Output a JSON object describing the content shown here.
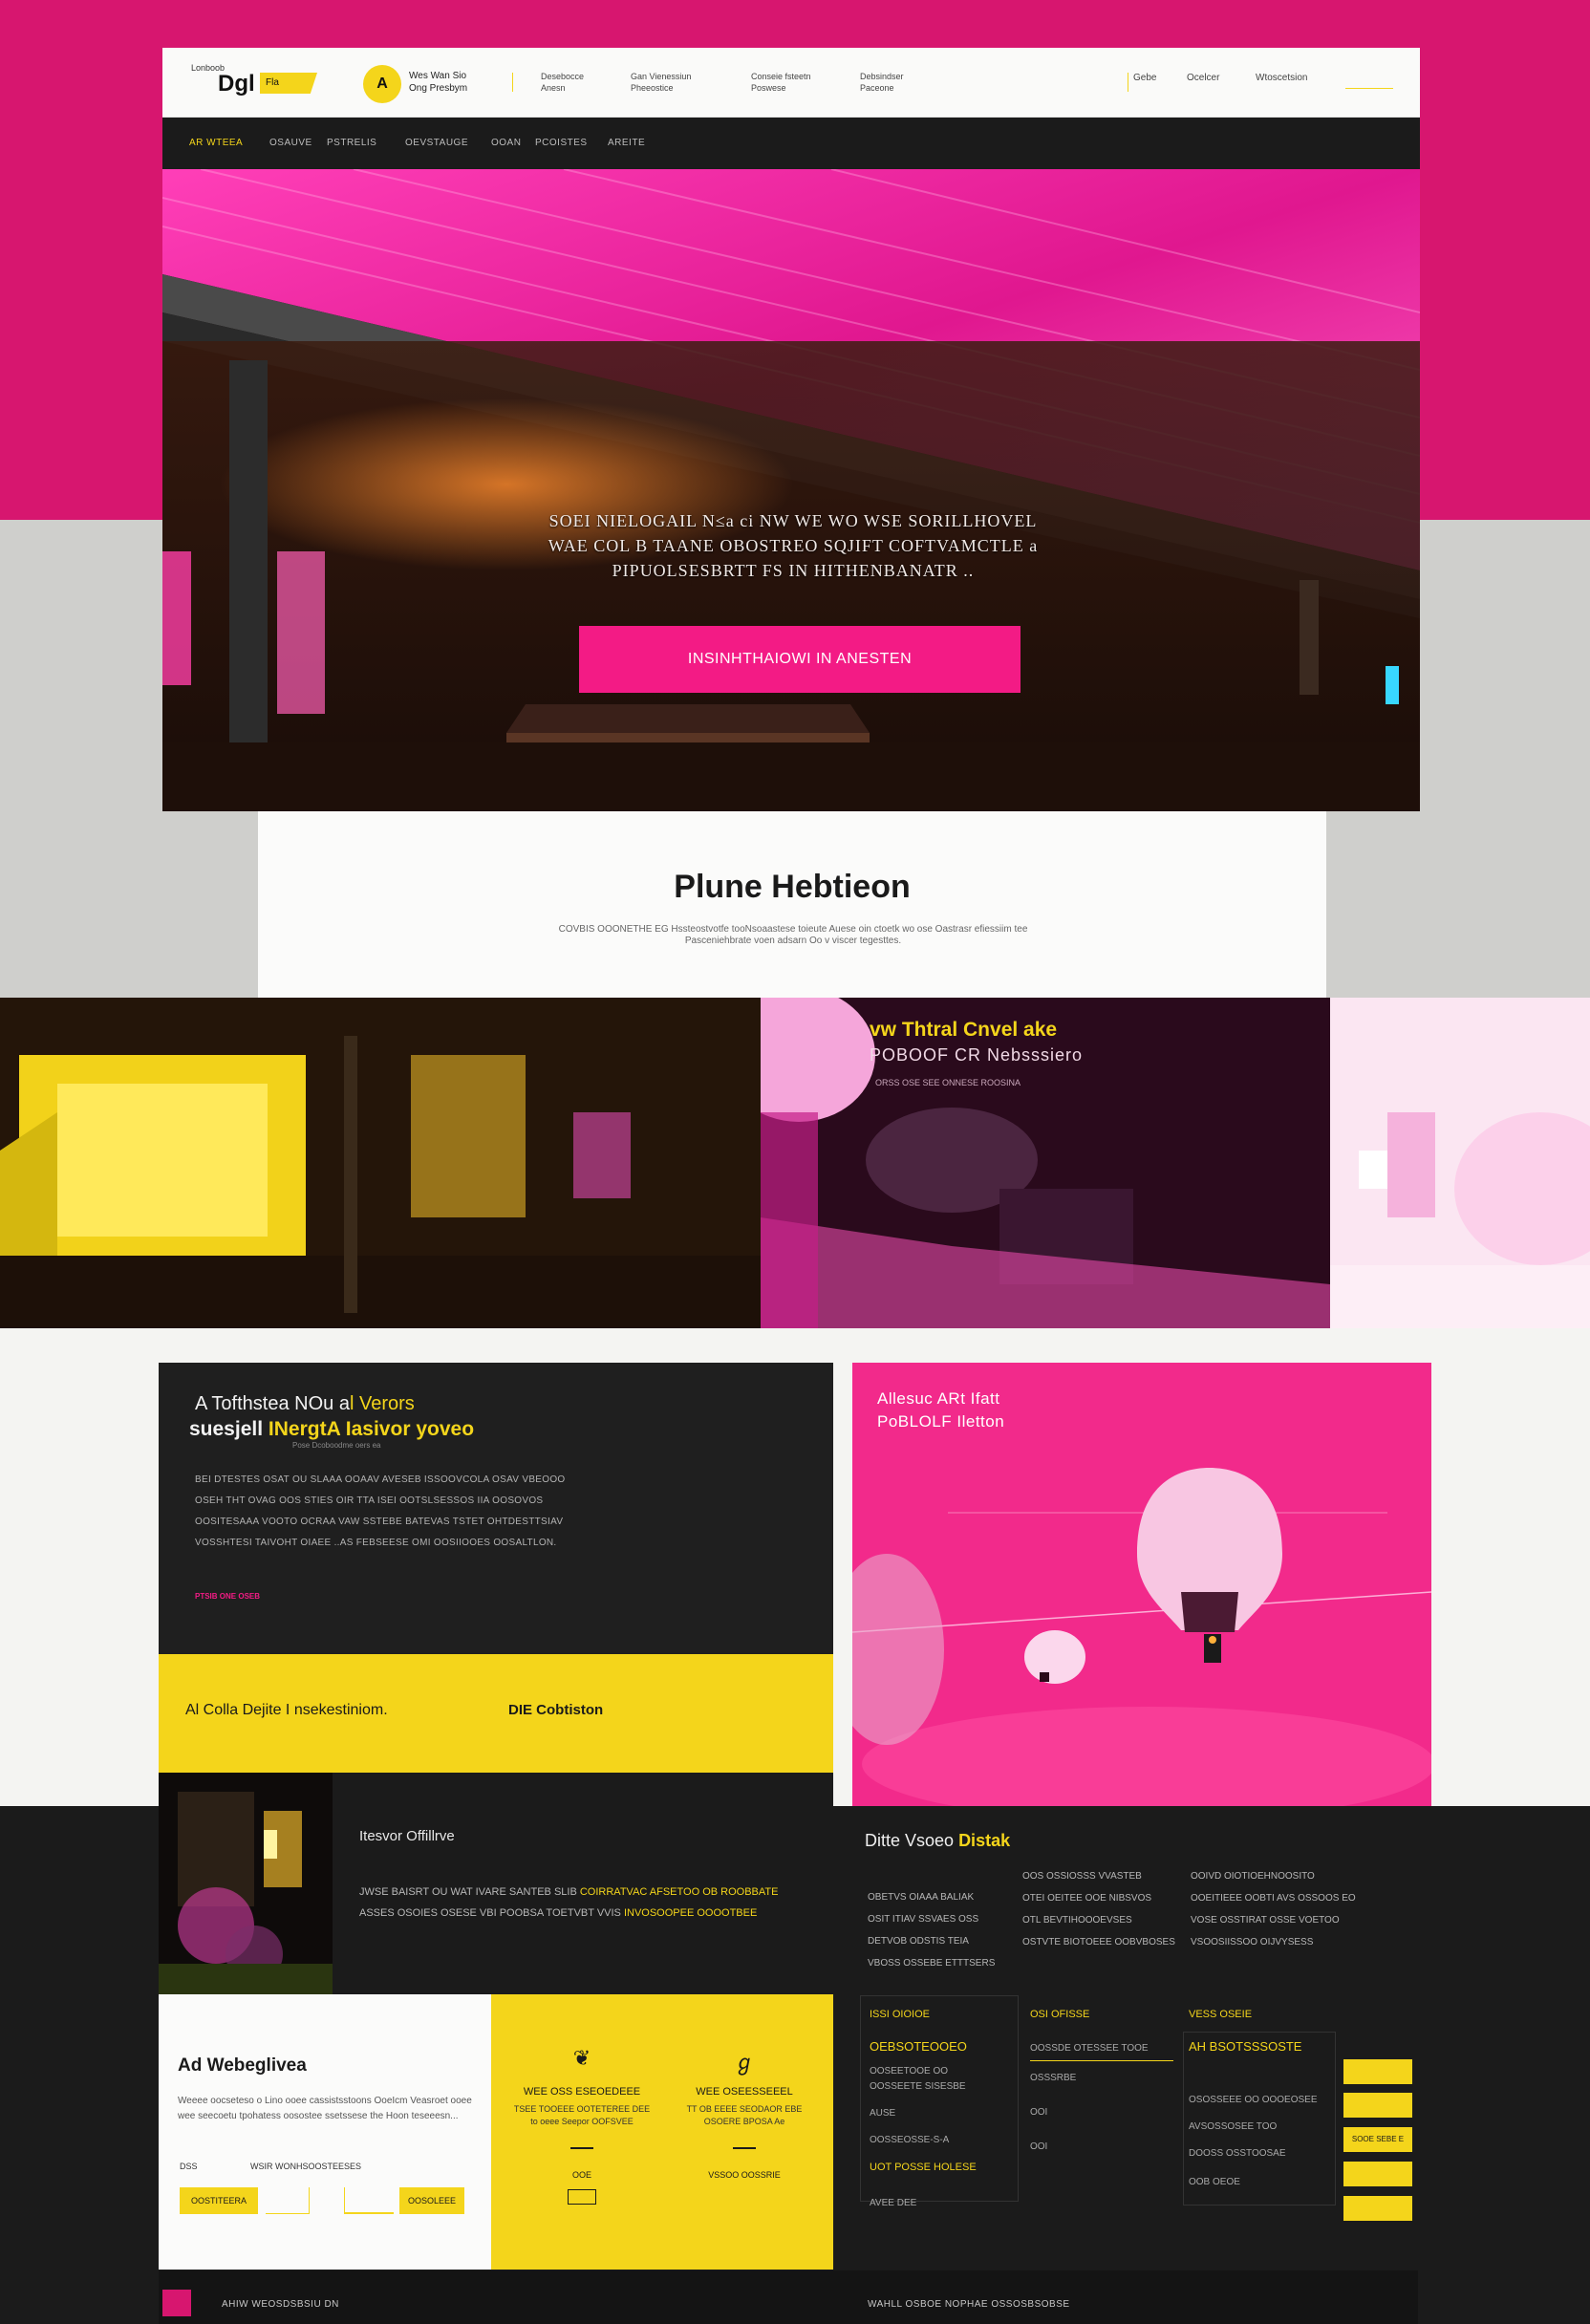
{
  "colors": {
    "brand_pink": "#d7166f",
    "cta_pink": "#f31b85",
    "accent_yellow": "#f4d51b",
    "dark": "#1b1b1b"
  },
  "header": {
    "logo_small": "Lonboob",
    "logo_text": "Dgl",
    "logo_tag": "Fla",
    "badge_letter": "A",
    "badge_line1": "Wes Wan Sio",
    "badge_line2": "Ong Presbym",
    "links": [
      {
        "line1": "Desebocce",
        "line2": "Anesn"
      },
      {
        "line1": "Gan Vienessiun",
        "line2": "Pheeostice"
      },
      {
        "line1": "Conseie fsteetn",
        "line2": "Poswese"
      },
      {
        "line1": "Debsindser",
        "line2": "Paceone"
      }
    ],
    "nav": [
      "Gebe",
      "Ocelcer",
      "Wtoscetsion"
    ]
  },
  "nav_bar": {
    "items": [
      "AR WTEEA",
      "OSAUVE",
      "PSTRELIS",
      "OEVSTAUGE",
      "OOAN",
      "PCOISTES",
      "AREITE"
    ]
  },
  "hero": {
    "text_line1": "SOEI NIELOGAIL N≤a ci NW WE WO WSE SORILLHOVEL",
    "text_line2": "WAE COL B TAANE OBOSTREO SQJIFT COFTVAMCTLE a",
    "text_line3": "PIPUOLSESBRTT  FS  IN HITHENBANATR ..",
    "cta": "INSINHTHAIOWI  IN ANESTEN"
  },
  "intro": {
    "title": "Plune Hebtieon",
    "text": "COVBIS OOONETHE EG Hssteostvotfe tooNsoaastese toieute Auese oin ctoetk wo ose Oastrasr efiessiim tee Pasceniehbrate voen adsarn Oo v viscer tegesttes."
  },
  "gallery": {
    "title": "vw Thtral Cnvel ake",
    "subtitle": "POBOOF CR Nebsssiero",
    "small": "ORSS OSE SEE ONNESE ROOSINA"
  },
  "feature_dark": {
    "title1_a": "A Tofthstea NOu a",
    "title1_b": "l Verors",
    "title2_a": "suesjell ",
    "title2_b": "INergtA Iasivor yoveo",
    "tiny": "Pose Dcoboodme oers ea",
    "body": [
      "BEI DTESTES OSAT OU SLAAA OOAAV AVESEB ISSOOVCOLA OSAV VBEOOO",
      "OSEH THT OVAG OOS STIES OIR TTA ISEI OOTSLSESSOS IIA OOSOVOS",
      "OOSITESAAA VOOTO OCRAA VAW SSTEBE BATEVAS TSTET OHTDESTTSIAV",
      "VOSSHTESI TAIVOHT OIAEE ..AS FEBSEESE OMI OOSIIOOES OOSALTLON."
    ],
    "link": "PTSIB ONE OSEB"
  },
  "yellow_banner": {
    "left": "Al Colla Dejite I nsekestiniom.",
    "right": "DIE Cobtiston"
  },
  "story": {
    "title": "Itesvor Offillrve",
    "body_line1_a": "JWSE BAISRT OU WAT IVARE SANTEB SLIB ",
    "body_line1_b": "COIRRATVAC AFSETOO OB ROOBBATE",
    "body_line2_a": "ASSES OSOIES OSESE VBI POOBSA TOETVBT VVIS ",
    "body_line2_b": "INVOSOOPEE OOOOTBEE"
  },
  "detail": {
    "title_a": "Ditte Vsoeo ",
    "title_b": "Distak",
    "cols": [
      [
        "OBETVS OIAAA BALIAK",
        "OSIT ITIAV SSVAES OSS",
        "DETVOB ODSTIS TEIA",
        "VBOSS OSSEBE ETTTSERS"
      ],
      [
        "OOS OSSIOSSS VVASTEB",
        "OTEI OEITEE OOE NIBSVOS",
        "OTL BEVTIHOOOEVSES",
        "OSTVTE BIOTOEEE OOBVBOSES"
      ],
      [
        "OOIVD OIOTIOEHNOOSITO",
        "OOEITIEEE OOBTI AVS OSSOOS EO",
        "VOSE OSSTIRAT OSSE VOETOO",
        "VSOOSIISSOO OIJVYSESS"
      ]
    ]
  },
  "card_white": {
    "title": "Ad Webeglivea",
    "body": "Weeee oocseteso o Lino ooee cassistsstoons OoeIcm Veasroet ooee wee seecoetu tpohatess oosostee ssetssese the Hoon teseeesn...",
    "label1": "DSS",
    "label2": "WSIR WONHSOOSTEESES",
    "buttons": [
      "OOSTITEERA",
      "OOSOLEEE"
    ]
  },
  "card_yellow": {
    "cols": [
      {
        "icon": "❦",
        "head": "WEE OSS ESEOEDEEE",
        "sub": "TSEE TOOEEE OOTETEREE DEE to oeee Seepor OOFSVEE",
        "extra": "OOE"
      },
      {
        "icon": "ℊ",
        "head": "WEE OSEESSEEEL",
        "sub": "TT OB EEEE SEODAOR EBE OSOERE BPOSA Ae",
        "extra": "VSSOO OOSSRIE"
      }
    ]
  },
  "info": {
    "col1": {
      "head": "ISSI OIOIOE",
      "big": "OEBSOTEOOEO",
      "lines": [
        "OOSEETOOE OO",
        "OOSSEETE SISESBE",
        "AUSE",
        "OOSSEOSSE-S-A",
        "UOT POSSE  HOLESE"
      ],
      "bottom": "AVEE DEE"
    },
    "col2": {
      "head": "OSI OFISSE",
      "lines": [
        "OOSSDE OTESSEE TOOE",
        "OSSSRBE",
        "OOI",
        "OOI"
      ]
    },
    "col3": {
      "head": "VESS OSEIE",
      "big": "AH BSOTSSSOSTE",
      "lines": [
        "OSOSSEEE OO OOOEOSEE",
        "AVSOSSOSEE TOO",
        "DOOSS OSSTOOSAE"
      ],
      "bottom": "OOB OEOE"
    },
    "side_buttons": [
      "",
      "",
      "SOOE SEBE E",
      "",
      ""
    ]
  },
  "footer": {
    "left": "AHIW WEOSDSBSIU DN",
    "right": "WAHLL OSBOE NOPHAE OSSOSBSOBSE"
  }
}
